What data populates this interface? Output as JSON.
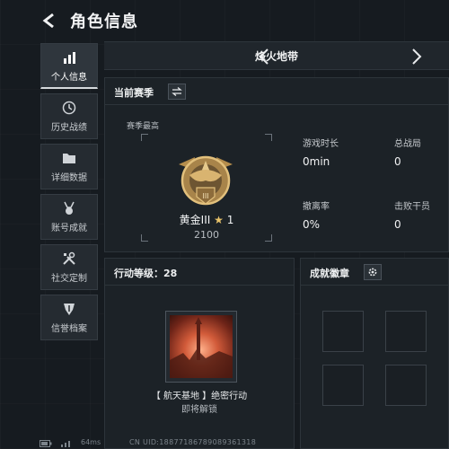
{
  "header": {
    "title": "角色信息",
    "back_icon": "back-arrow-icon"
  },
  "sidebar": {
    "items": [
      {
        "label": "个人信息",
        "icon": "bar-chart-icon",
        "active": true
      },
      {
        "label": "历史战绩",
        "icon": "clock-icon",
        "active": false
      },
      {
        "label": "详细数据",
        "icon": "folder-icon",
        "active": false
      },
      {
        "label": "账号成就",
        "icon": "medal-icon",
        "active": false
      },
      {
        "label": "社交定制",
        "icon": "tools-icon",
        "active": false
      },
      {
        "label": "信誉档案",
        "icon": "shield-icon",
        "active": false
      }
    ]
  },
  "mode": {
    "label": "烽火地带",
    "prev_icon": "chevron-left-icon",
    "next_icon": "chevron-right-icon"
  },
  "season": {
    "title": "当前赛季",
    "switch_icon": "swap-icon",
    "best_label": "赛季最高",
    "rank_name": "黄金III",
    "rank_star": "★",
    "rank_stars": "1",
    "rank_score": "2100",
    "stats": [
      {
        "label": "游戏时长",
        "value": "0min"
      },
      {
        "label": "总战局",
        "value": "0"
      },
      {
        "label": "撤离率",
        "value": "0%"
      },
      {
        "label": "击败干员",
        "value": "0"
      }
    ]
  },
  "action": {
    "title": "行动等级：28",
    "mission_name": "【 航天基地 】绝密行动",
    "mission_status": "即将解锁"
  },
  "achievements": {
    "title": "成就徽章",
    "settings_icon": "gear-icon"
  },
  "footer": {
    "ping": "64ms",
    "uid": "CN UID:18877186789089361318"
  },
  "colors": {
    "background": "#161b20",
    "panel": "#1c2227",
    "gold": "#c9a45c",
    "star": "#e9c36a"
  }
}
